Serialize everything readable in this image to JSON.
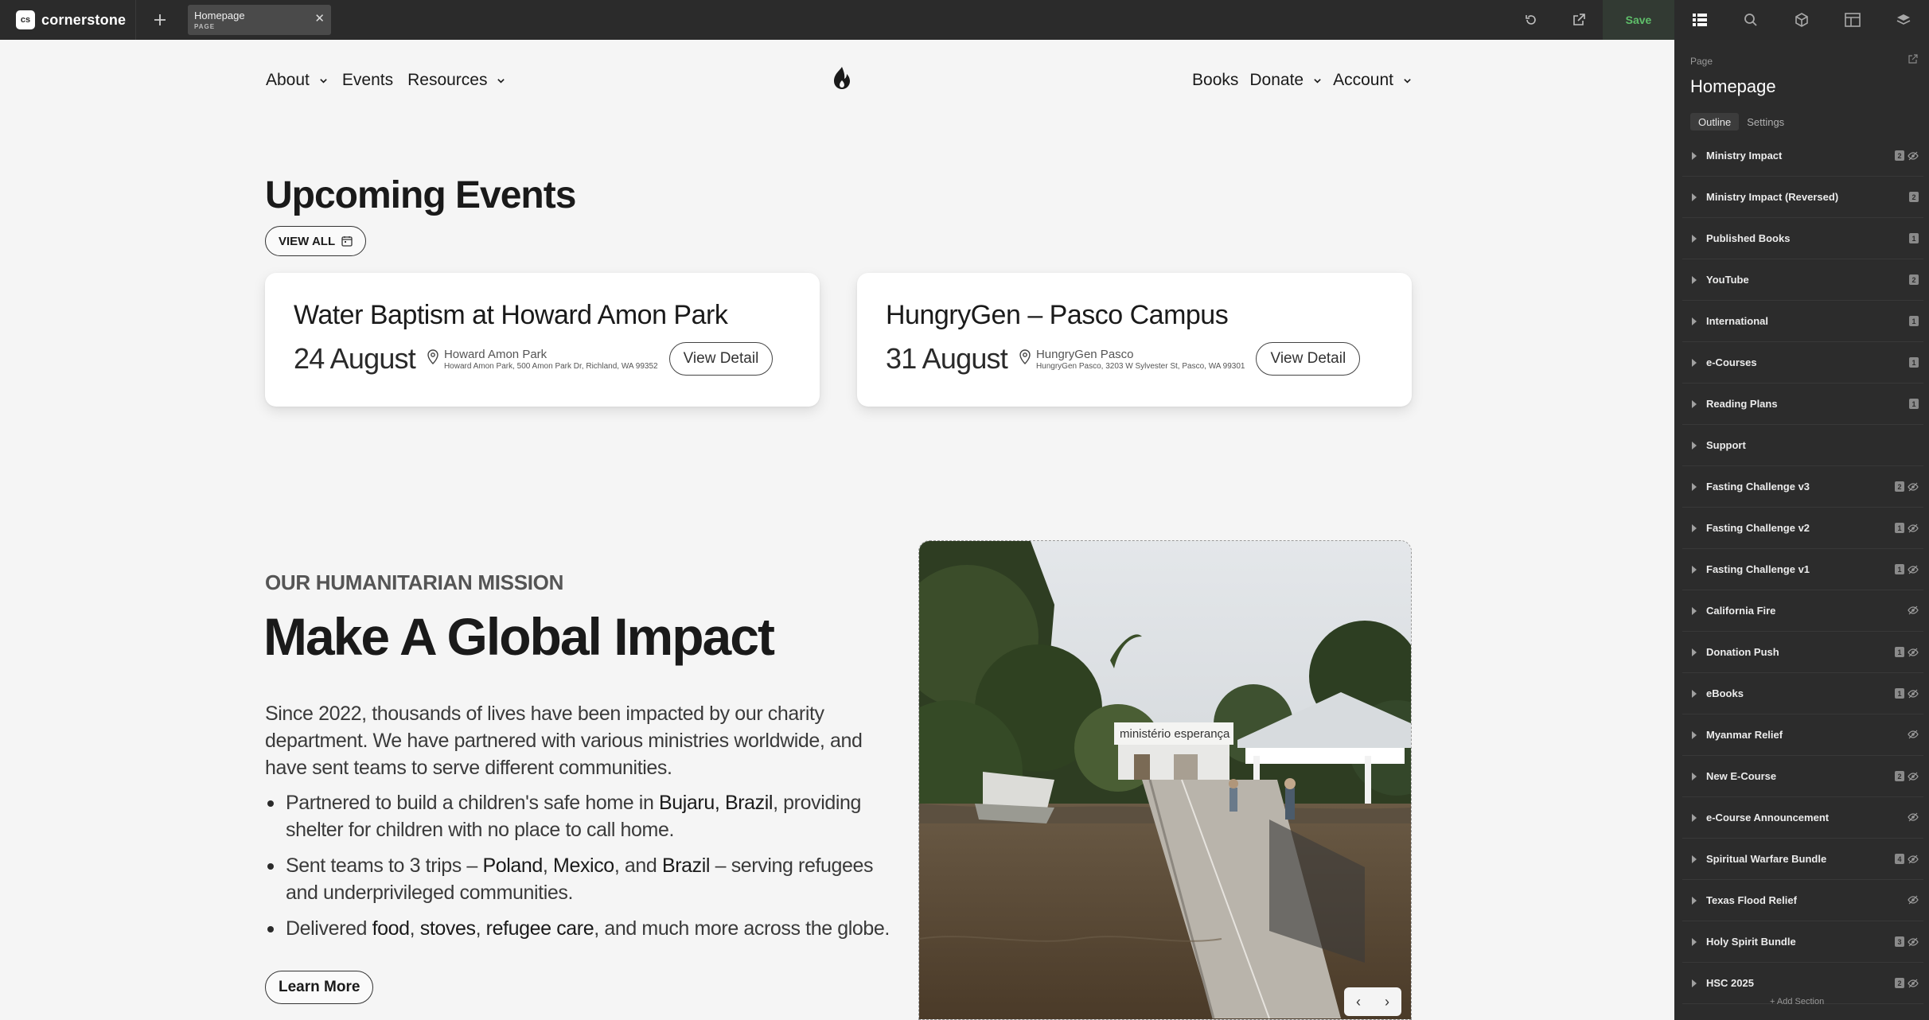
{
  "topbar": {
    "brand_logo": "cs",
    "brand_name": "cornerstone",
    "tab_title": "Homepage",
    "tab_type": "PAGE",
    "save_label": "Save"
  },
  "nav": {
    "left": [
      {
        "label": "About",
        "dropdown": true
      },
      {
        "label": "Events",
        "dropdown": false
      },
      {
        "label": "Resources",
        "dropdown": true
      }
    ],
    "right": [
      {
        "label": "Books",
        "dropdown": false
      },
      {
        "label": "Donate",
        "dropdown": true
      },
      {
        "label": "Account",
        "dropdown": true
      }
    ]
  },
  "events": {
    "title": "Upcoming Events",
    "view_all": "VIEW ALL",
    "cards": [
      {
        "title": "Water Baptism at Howard Amon Park",
        "date": "24 August",
        "location_name": "Howard Amon Park",
        "location_address": "Howard Amon Park, 500 Amon Park Dr, Richland, WA 99352",
        "button": "View Detail"
      },
      {
        "title": "HungryGen – Pasco Campus",
        "date": "31 August",
        "location_name": "HungryGen Pasco",
        "location_address": "HungryGen Pasco, 3203 W Sylvester St, Pasco, WA 99301",
        "button": "View Detail"
      }
    ]
  },
  "mission": {
    "kicker": "OUR HUMANITARIAN MISSION",
    "title": "Make A Global Impact",
    "body": "Since 2022, thousands of lives have been impacted by our charity department. We have partnered with various ministries worldwide, and have sent teams to serve different communities.",
    "bullets": [
      {
        "pre": "Partnered to build a children's safe home in ",
        "b1": "Bujaru, Brazil",
        "post": ", providing shelter for children with no place to call home."
      },
      {
        "pre": "Sent teams to 3 trips – ",
        "b1": "Poland",
        "m1": ", ",
        "b2": "Mexico",
        "m2": ", and ",
        "b3": "Brazil",
        "post": " – serving refugees and underprivileged communities."
      },
      {
        "pre": "Delivered ",
        "b1": "food",
        "m1": ", ",
        "b2": "stoves",
        "m2": ", ",
        "b3": "refugee care",
        "post": ", and much more across the globe."
      }
    ],
    "learn_more": "Learn More",
    "photo_sign": "ministério esperança"
  },
  "panel": {
    "label": "Page",
    "title": "Homepage",
    "tabs": [
      "Outline",
      "Settings"
    ],
    "active_tab": "Outline",
    "sections": [
      {
        "name": "Ministry Impact",
        "count": "2",
        "hidden": true
      },
      {
        "name": "Ministry Impact (Reversed)",
        "count": "2",
        "hidden": false
      },
      {
        "name": "Published Books",
        "count": "1",
        "hidden": false
      },
      {
        "name": "YouTube",
        "count": "2",
        "hidden": false
      },
      {
        "name": "International",
        "count": "1",
        "hidden": false
      },
      {
        "name": "e-Courses",
        "count": "1",
        "hidden": false
      },
      {
        "name": "Reading Plans",
        "count": "1",
        "hidden": false
      },
      {
        "name": "Support",
        "count": "",
        "hidden": false
      },
      {
        "name": "Fasting Challenge v3",
        "count": "2",
        "hidden": true
      },
      {
        "name": "Fasting Challenge v2",
        "count": "1",
        "hidden": true
      },
      {
        "name": "Fasting Challenge v1",
        "count": "1",
        "hidden": true
      },
      {
        "name": "California Fire",
        "count": "",
        "hidden": true
      },
      {
        "name": "Donation Push",
        "count": "1",
        "hidden": true
      },
      {
        "name": "eBooks",
        "count": "1",
        "hidden": true
      },
      {
        "name": "Myanmar Relief",
        "count": "",
        "hidden": true
      },
      {
        "name": "New E-Course",
        "count": "2",
        "hidden": true
      },
      {
        "name": "e-Course Announcement",
        "count": "",
        "hidden": true
      },
      {
        "name": "Spiritual Warfare Bundle",
        "count": "4",
        "hidden": true
      },
      {
        "name": "Texas Flood Relief",
        "count": "",
        "hidden": true
      },
      {
        "name": "Holy Spirit Bundle",
        "count": "3",
        "hidden": true
      },
      {
        "name": "HSC 2025",
        "count": "2",
        "hidden": true
      }
    ],
    "add_section": "+ Add Section"
  },
  "colors": {
    "topbar_bg": "#2b2b2b",
    "panel_bg": "#2c2c2c",
    "canvas_bg": "#f5f5f5",
    "save_green": "#5fbf6a"
  },
  "icons": [
    "undo-icon",
    "external-link-icon",
    "outline-icon",
    "search-icon",
    "elements-icon",
    "layout-icon",
    "layers-icon",
    "calendar-icon",
    "map-pin-icon",
    "eye-off-icon",
    "chevron-down-icon",
    "chevron-left-icon",
    "chevron-right-icon"
  ]
}
